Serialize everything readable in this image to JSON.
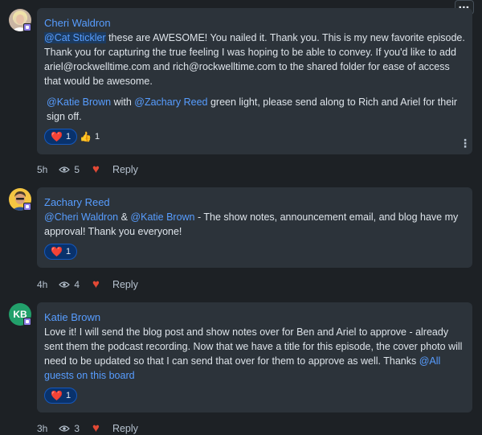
{
  "toolbar": {
    "more_label": "⋯"
  },
  "comments": [
    {
      "author": "Cheri Waldron",
      "avatar_icon": "user-photo-icon",
      "body": {
        "p1_mention": "@Cat Stickler",
        "p1_text": " these are AWESOME!  You nailed it.  Thank you.  This is my new favorite episode. Thank you for capturing the true feeling I was hoping to be able to convey. If you'd like to add ariel@rockwelltime.com and rich@rockwelltime.com to the shared folder for ease of access that would be awesome.",
        "p2_mention1": "@Katie Brown",
        "p2_mid": " with ",
        "p2_mention2": "@Zachary Reed",
        "p2_text": " green light, please send along to Rich and Ariel for their sign off."
      },
      "reactions": [
        {
          "emoji": "❤️",
          "count": "1"
        },
        {
          "emoji": "👍",
          "count": "1"
        }
      ],
      "time": "5h",
      "views": "5",
      "reply_label": "Reply"
    },
    {
      "author": "Zachary Reed",
      "avatar_icon": "user-photo-icon",
      "body": {
        "mention1": "@Cheri Waldron",
        "amp": " & ",
        "mention2": "@Katie Brown",
        "text": " - The show notes, announcement email, and blog have my approval! Thank you everyone!"
      },
      "reactions": [
        {
          "emoji": "❤️",
          "count": "1"
        }
      ],
      "time": "4h",
      "views": "4",
      "reply_label": "Reply"
    },
    {
      "author": "Katie Brown",
      "avatar_initials": "KB",
      "body": {
        "text": "Love it! I will send the blog post and show notes over for Ben and Ariel to approve - already sent them the podcast recording. Now that we have a title for this episode, the cover photo will need to be updated so that I can send that over for them to approve as well. Thanks ",
        "mention": "@All guests on this board"
      },
      "reactions": [
        {
          "emoji": "❤️",
          "count": "1"
        }
      ],
      "time": "3h",
      "views": "3",
      "reply_label": "Reply"
    }
  ],
  "colors": {
    "background": "#1d2125",
    "bubble": "#2c333a",
    "accent": "#579dff",
    "heart": "#e34935",
    "kb_avatar": "#22a06b"
  }
}
